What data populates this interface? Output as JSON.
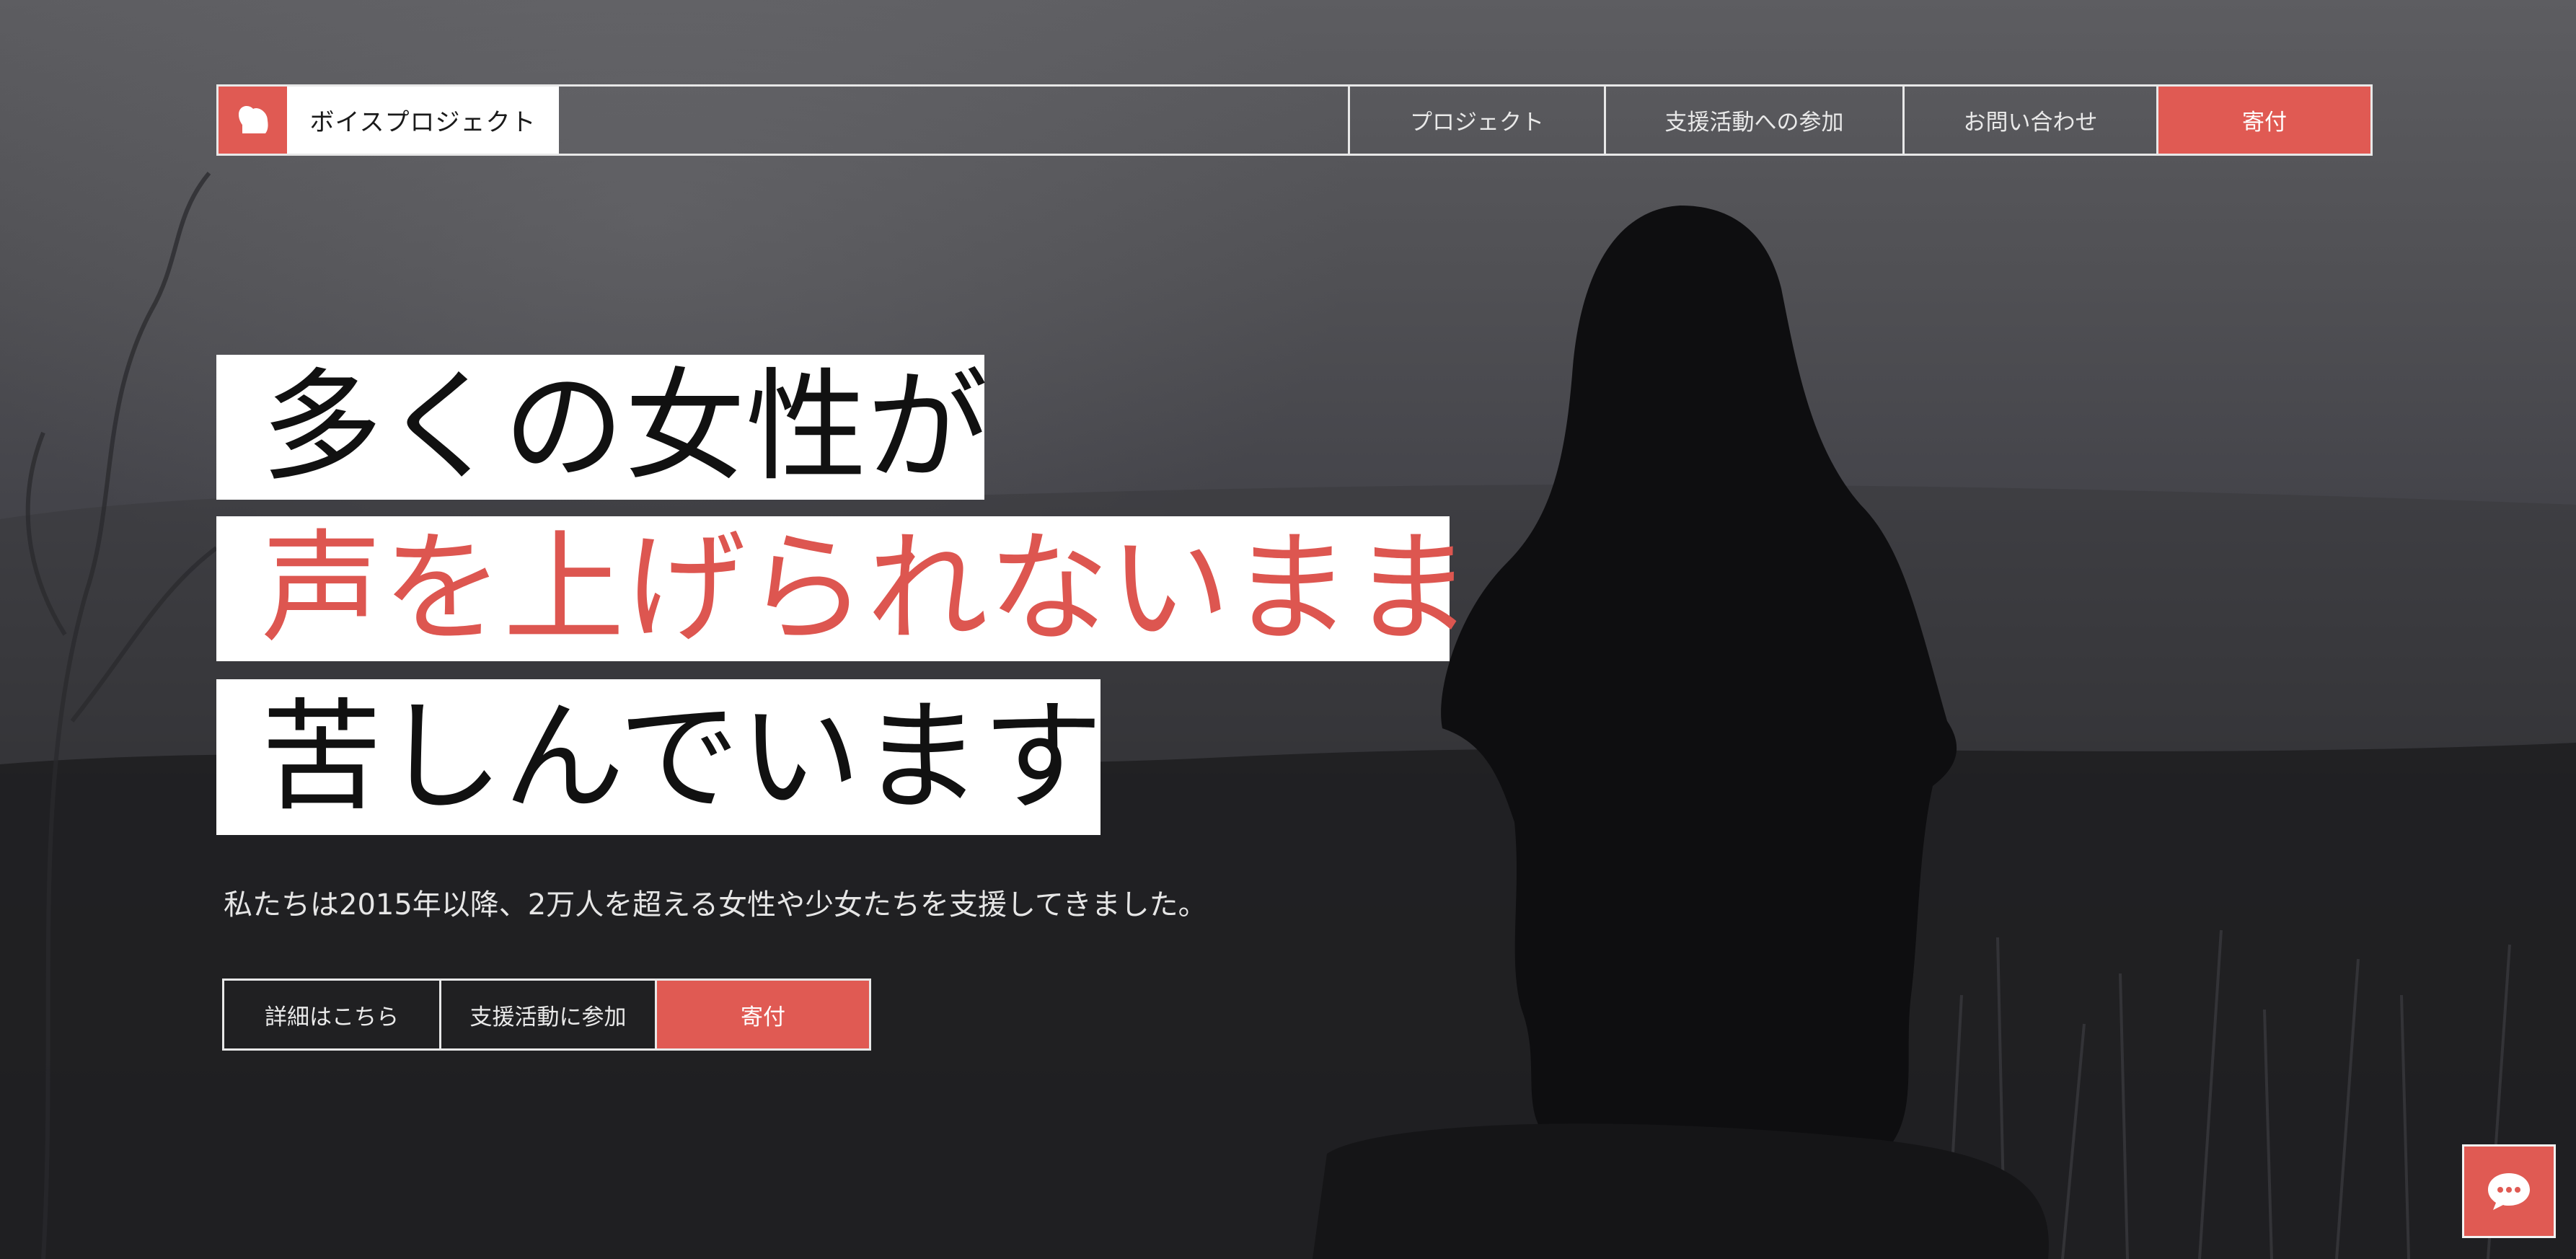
{
  "brand": {
    "name": "ボイスプロジェクト",
    "logo_icon": "heart-bubble-icon"
  },
  "nav": {
    "items": [
      {
        "label": "プロジェクト"
      },
      {
        "label": "支援活動への参加"
      },
      {
        "label": "お問い合わせ"
      },
      {
        "label": "寄付"
      }
    ]
  },
  "hero": {
    "line1": "多くの女性が",
    "line2": "声を上げられないまま",
    "line3": "苦しんでいます",
    "subtext": "私たちは2015年以降、2万人を超える女性や少女たちを支援してきました。"
  },
  "cta": {
    "more_label": "詳細はこちら",
    "join_label": "支援活動に参加",
    "donate_label": "寄付"
  },
  "chat": {
    "icon": "chat-icon"
  },
  "colors": {
    "accent": "#e05a53",
    "headline_accent": "#dd5650"
  }
}
